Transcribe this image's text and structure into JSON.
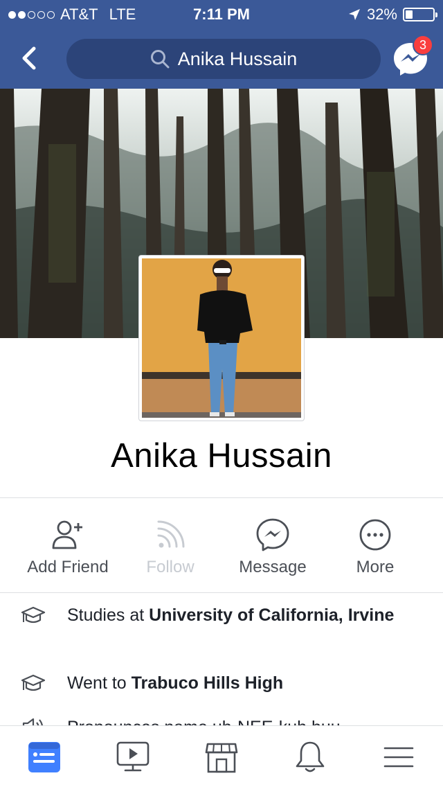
{
  "status_bar": {
    "carrier": "AT&T",
    "network": "LTE",
    "time": "7:11 PM",
    "battery": "32%",
    "battery_level": 0.32,
    "signal_bars_filled": 2,
    "signal_bars_total": 5
  },
  "navbar": {
    "back_icon": "chevron-left-icon",
    "search_icon": "search-icon",
    "search_text": "Anika Hussain",
    "messenger_icon": "messenger-icon",
    "messenger_badge": "3"
  },
  "profile": {
    "name": "Anika Hussain",
    "cover_photo": "forest-tree-canopy",
    "profile_photo": "person-against-yellow-wall"
  },
  "actions": [
    {
      "label": "Add Friend",
      "icon": "add-friend-icon",
      "enabled": true
    },
    {
      "label": "Follow",
      "icon": "follow-feed-icon",
      "enabled": false
    },
    {
      "label": "Message",
      "icon": "messenger-icon",
      "enabled": true
    },
    {
      "label": "More",
      "icon": "more-dots-icon",
      "enabled": true
    }
  ],
  "about": [
    {
      "icon": "graduation-cap-icon",
      "prefix": "Studies at ",
      "bold": "University of California, Irvine"
    },
    {
      "icon": "graduation-cap-icon",
      "prefix": "Went to ",
      "bold": "Trabuco Hills High"
    },
    {
      "icon": "speaker-icon",
      "prefix": "Pronounces name uh-NEE-kuh huu",
      "bold": ""
    }
  ],
  "tabbar": [
    {
      "name": "news-feed-tab",
      "icon": "news-feed-icon",
      "active": true
    },
    {
      "name": "watch-tab",
      "icon": "watch-video-icon",
      "active": false
    },
    {
      "name": "marketplace-tab",
      "icon": "marketplace-icon",
      "active": false
    },
    {
      "name": "notifications-tab",
      "icon": "bell-icon",
      "active": false
    },
    {
      "name": "menu-tab",
      "icon": "hamburger-menu-icon",
      "active": false
    }
  ],
  "colors": {
    "brand": "#3b5998",
    "badge": "#fa3e3e",
    "icon_gray": "#4b4f56",
    "disabled": "#c7cbd1",
    "active_tab": "#4080ff"
  }
}
